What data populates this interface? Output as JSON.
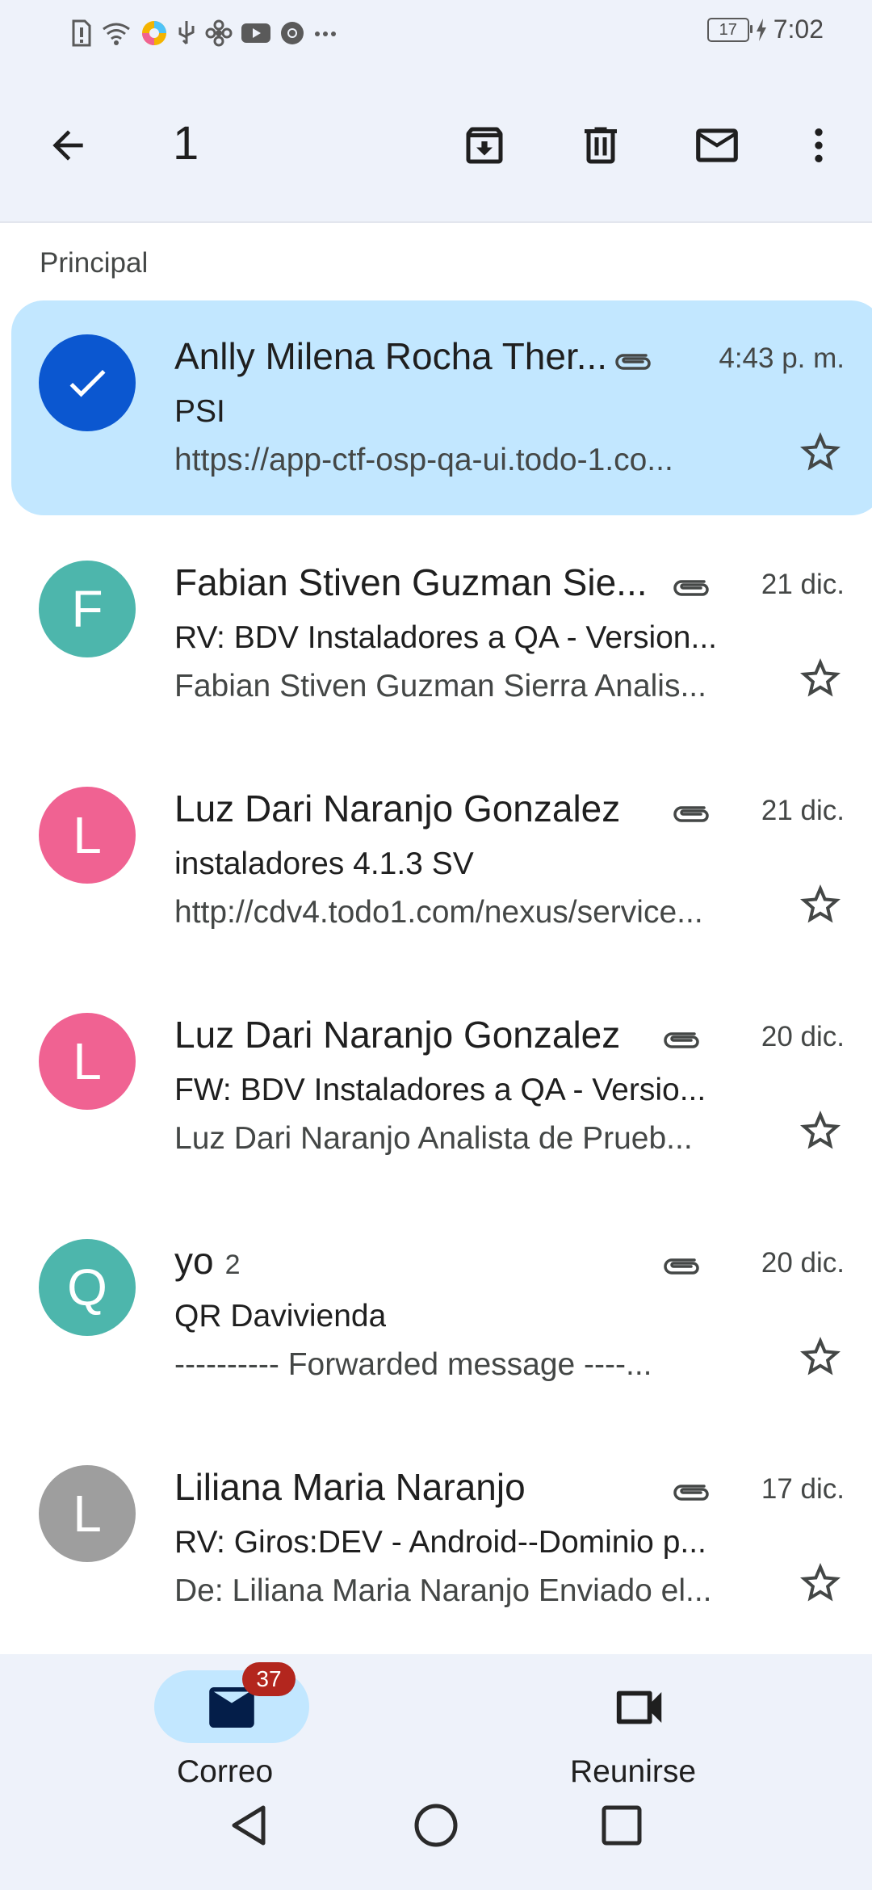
{
  "status_bar": {
    "battery": "17",
    "time": "7:02"
  },
  "action_bar": {
    "selected_count": "1"
  },
  "section_label": "Principal",
  "emails": [
    {
      "sender": "Anlly Milena Rocha Ther...",
      "subject": "PSI",
      "snippet": "https://app-ctf-osp-qa-ui.todo-1.co...",
      "date": "4:43 p. m.",
      "avatar_letter": "",
      "avatar_color": "#0b57d0",
      "selected": true,
      "attachment": true
    },
    {
      "sender": "Fabian Stiven  Guzman Sie...",
      "subject": "RV: BDV Instaladores a QA - Version...",
      "snippet": "Fabian Stiven Guzman Sierra Analis...",
      "date": "21 dic.",
      "avatar_letter": "F",
      "avatar_color": "#4db6ac",
      "selected": false,
      "attachment": true
    },
    {
      "sender": "Luz Dari Naranjo Gonzalez",
      "subject": "instaladores 4.1.3 SV",
      "snippet": "http://cdv4.todo1.com/nexus/service...",
      "date": "21 dic.",
      "avatar_letter": "L",
      "avatar_color": "#f06292",
      "selected": false,
      "attachment": true
    },
    {
      "sender": "Luz Dari Naranjo Gonzalez",
      "subject": "FW: BDV Instaladores a QA - Versio...",
      "snippet": "Luz Dari Naranjo Analista de Prueb...",
      "date": "20 dic.",
      "avatar_letter": "L",
      "avatar_color": "#f06292",
      "selected": false,
      "attachment": true
    },
    {
      "sender": "yo",
      "count": "2",
      "subject": "QR Davivienda",
      "snippet": "---------- Forwarded message ----...",
      "date": "20 dic.",
      "avatar_letter": "Q",
      "avatar_color": "#4db6ac",
      "selected": false,
      "attachment": true
    },
    {
      "sender": "Liliana Maria Naranjo",
      "subject": "RV: Giros:DEV - Android--Dominio p...",
      "snippet": "De: Liliana Maria Naranjo Enviado el...",
      "date": "17 dic.",
      "avatar_letter": "L",
      "avatar_color": "#9e9e9e",
      "selected": false,
      "attachment": true
    }
  ],
  "bottom_nav": {
    "mail_label": "Correo",
    "mail_badge": "37",
    "meet_label": "Reunirse"
  },
  "icons": [
    "back-arrow-icon",
    "archive-icon",
    "delete-icon",
    "mark-unread-icon",
    "more-vert-icon",
    "attachment-icon",
    "star-icon",
    "check-icon",
    "mail-icon",
    "video-icon",
    "nav-back-icon",
    "nav-home-icon",
    "nav-recents-icon"
  ],
  "colors": {
    "selected_row": "#c2e7ff",
    "selected_avatar": "#0b57d0",
    "badge": "#b3261e",
    "surface": "#eef2fa"
  }
}
